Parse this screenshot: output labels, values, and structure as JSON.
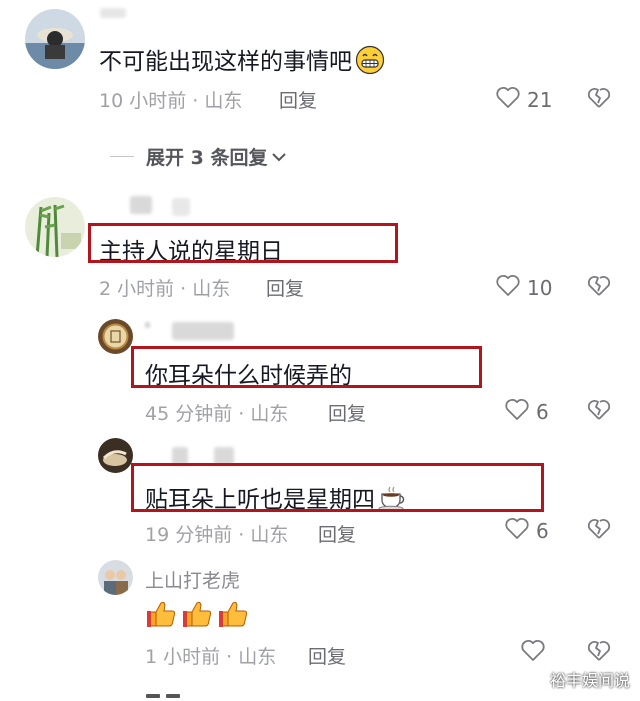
{
  "comments": [
    {
      "text": "不可能出现这样的事情吧",
      "emoji_icon": "grinning-face-icon",
      "time": "10 小时前 · 山东",
      "reply": "回复",
      "likes": "21"
    },
    {
      "text": "主持人说的星期日",
      "time": "2 小时前 · 山东",
      "reply": "回复",
      "likes": "10"
    },
    {
      "text": "你耳朵什么时候弄的",
      "time": "45 分钟前 · 山东",
      "reply": "回复",
      "likes": "6"
    },
    {
      "text": "贴耳朵上听也是星期四",
      "emoji_icon": "coffee-cup-icon",
      "time": "19 分钟前 · 山东",
      "reply": "回复",
      "likes": "6"
    },
    {
      "username": "上山打老虎",
      "emoji_icon": "thumbs-up-icon",
      "time": "1 小时前 · 山东",
      "reply": "回复"
    }
  ],
  "expand_replies": "展开 3 条回复",
  "watermark": "裕丰娱间说",
  "colors": {
    "highlight": "#b2151b",
    "meta": "#a0a1a6"
  }
}
